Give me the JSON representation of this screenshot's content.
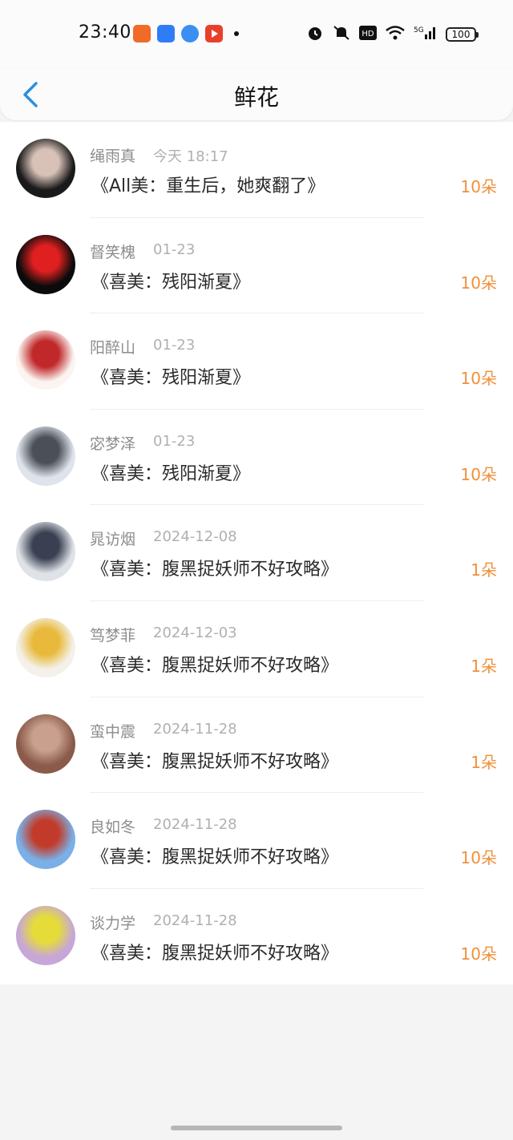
{
  "status_bar": {
    "time": "23:40",
    "notification_icons": [
      {
        "name": "app-icon-orange",
        "color": "#f06a28"
      },
      {
        "name": "app-icon-blue",
        "color": "#2f7df6"
      },
      {
        "name": "app-icon-lightblue",
        "color": "#3b8ff0"
      },
      {
        "name": "app-icon-red-play",
        "color": "#e8402c"
      }
    ],
    "hd_label": "HD",
    "network_label": "5G",
    "battery": "100"
  },
  "header": {
    "title": "鲜花",
    "back_icon": "chevron-left-icon",
    "accent_color": "#2a8fe0"
  },
  "list": {
    "items": [
      {
        "name": "绳雨真",
        "date": "今天 18:17",
        "book": "《All美：重生后，她爽翻了》",
        "count": "10朵",
        "avatar_colors": [
          "#1a1a1a",
          "#d8c2b8"
        ]
      },
      {
        "name": "督笑槐",
        "date": "01-23",
        "book": "《喜美：残阳渐夏》",
        "count": "10朵",
        "avatar_colors": [
          "#0b0b0b",
          "#e02020"
        ]
      },
      {
        "name": "阳醉山",
        "date": "01-23",
        "book": "《喜美：残阳渐夏》",
        "count": "10朵",
        "avatar_colors": [
          "#fbf4f0",
          "#c0282a"
        ]
      },
      {
        "name": "宓梦泽",
        "date": "01-23",
        "book": "《喜美：残阳渐夏》",
        "count": "10朵",
        "avatar_colors": [
          "#dfe4ec",
          "#4a4f58"
        ]
      },
      {
        "name": "晁访烟",
        "date": "2024-12-08",
        "book": "《喜美：腹黑捉妖师不好攻略》",
        "count": "1朵",
        "avatar_colors": [
          "#dfe3e8",
          "#3a3f52"
        ]
      },
      {
        "name": "笃梦菲",
        "date": "2024-12-03",
        "book": "《喜美：腹黑捉妖师不好攻略》",
        "count": "1朵",
        "avatar_colors": [
          "#f4f1ea",
          "#e8b93a"
        ]
      },
      {
        "name": "蛮中震",
        "date": "2024-11-28",
        "book": "《喜美：腹黑捉妖师不好攻略》",
        "count": "1朵",
        "avatar_colors": [
          "#8a5a4a",
          "#c9a08e"
        ]
      },
      {
        "name": "良如冬",
        "date": "2024-11-28",
        "book": "《喜美：腹黑捉妖师不好攻略》",
        "count": "10朵",
        "avatar_colors": [
          "#7ab0e8",
          "#c23b2a"
        ]
      },
      {
        "name": "谈力学",
        "date": "2024-11-28",
        "book": "《喜美：腹黑捉妖师不好攻略》",
        "count": "10朵",
        "avatar_colors": [
          "#c7a6d8",
          "#e5dc3a"
        ]
      }
    ]
  },
  "colors": {
    "flower_count": "#f0903a",
    "name": "#8d8d8d",
    "date": "#b0b0b0"
  }
}
